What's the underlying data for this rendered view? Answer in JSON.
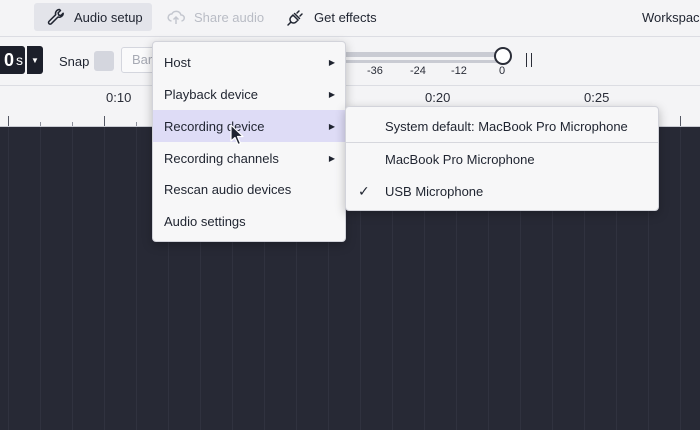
{
  "toolbar": {
    "audio_setup": "Audio setup",
    "share_audio": "Share audio",
    "get_effects": "Get effects",
    "workspace": "Workspac"
  },
  "toolbar2": {
    "time_value": "0",
    "time_unit": "s",
    "snap_label": "Snap",
    "bar_field": "Bar",
    "meter_ticks": [
      "-36",
      "-24",
      "-12",
      "0"
    ]
  },
  "ruler": {
    "labels": [
      "0:10",
      "0:20",
      "0:25"
    ]
  },
  "menu": {
    "items": [
      {
        "label": "Host",
        "has_submenu": true
      },
      {
        "label": "Playback device",
        "has_submenu": true
      },
      {
        "label": "Recording device",
        "has_submenu": true,
        "highlighted": true
      },
      {
        "label": "Recording channels",
        "has_submenu": true
      },
      {
        "label": "Rescan audio devices",
        "has_submenu": false
      },
      {
        "label": "Audio settings",
        "has_submenu": false
      }
    ]
  },
  "submenu": {
    "items": [
      {
        "label": "System default: MacBook Pro Microphone",
        "checked": false
      },
      {
        "label": "MacBook Pro Microphone",
        "checked": false
      },
      {
        "label": "USB Microphone",
        "checked": true
      }
    ]
  },
  "colors": {
    "track_bg": "#272935",
    "highlight": "#dedcf6",
    "toolbar_bg": "#f4f4f6"
  }
}
